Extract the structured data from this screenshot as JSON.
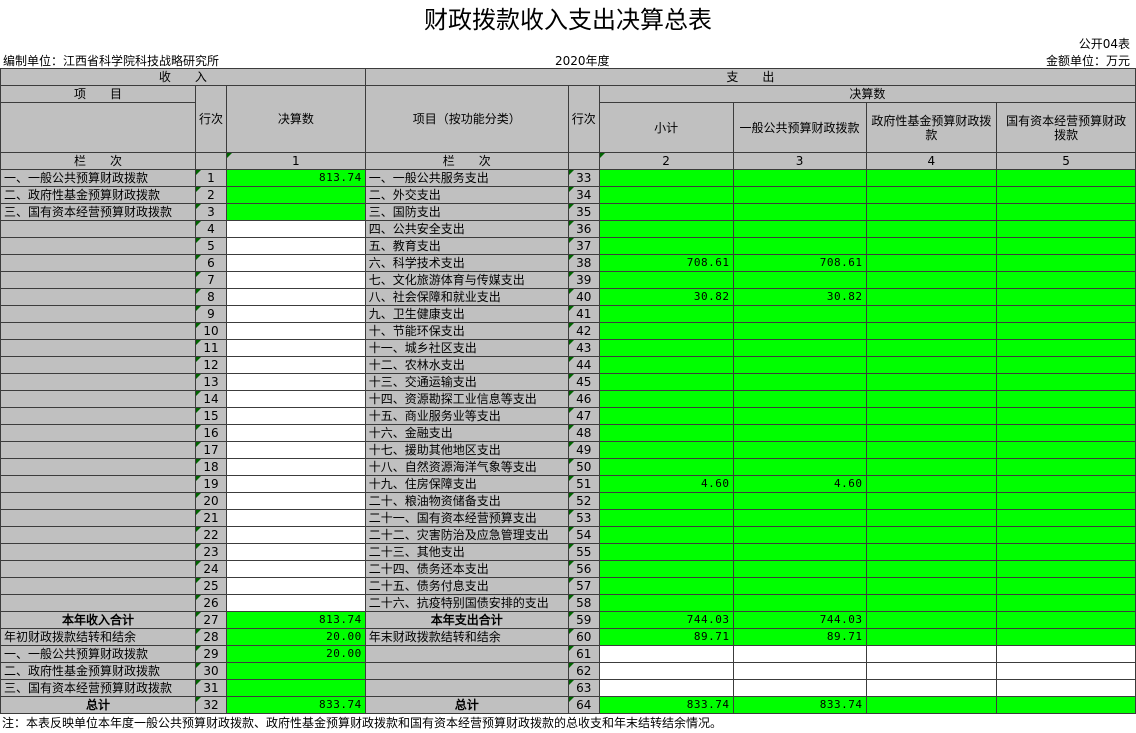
{
  "title": "财政拨款收入支出决算总表",
  "form_code": "公开04表",
  "unit_label": "编制单位：江西省科学院科技战略研究所",
  "year": "2020年度",
  "money_unit": "金额单位：万元",
  "header": {
    "income": "收　　入",
    "expense": "支　　出",
    "item": "项　　目",
    "seq": "行次",
    "amount": "决算数",
    "item_by_func": "项目（按功能分类）",
    "amount_group": "决算数",
    "subtotal": "小计",
    "general_budget": "一般公共预算财政拨款",
    "gov_fund": "政府性基金预算财政拨款",
    "state_capital": "国有资本经营预算财政拨款",
    "col_label": "栏　　次",
    "col1": "1",
    "col2": "2",
    "col3": "3",
    "col4": "4",
    "col5": "5"
  },
  "rows": [
    {
      "in_label": "一、一般公共预算财政拨款",
      "in_no": "1",
      "in_amt": "813.74",
      "ex_label": "一、一般公共服务支出",
      "ex_no": "33",
      "sub": "",
      "gen": "",
      "gov": "",
      "cap": ""
    },
    {
      "in_label": "二、政府性基金预算财政拨款",
      "in_no": "2",
      "in_amt": "",
      "ex_label": "二、外交支出",
      "ex_no": "34",
      "sub": "",
      "gen": "",
      "gov": "",
      "cap": ""
    },
    {
      "in_label": "三、国有资本经营预算财政拨款",
      "in_no": "3",
      "in_amt": "",
      "ex_label": "三、国防支出",
      "ex_no": "35",
      "sub": "",
      "gen": "",
      "gov": "",
      "cap": ""
    },
    {
      "in_label": "",
      "in_no": "4",
      "in_amt": "",
      "ex_label": "四、公共安全支出",
      "ex_no": "36",
      "sub": "",
      "gen": "",
      "gov": "",
      "cap": ""
    },
    {
      "in_label": "",
      "in_no": "5",
      "in_amt": "",
      "ex_label": "五、教育支出",
      "ex_no": "37",
      "sub": "",
      "gen": "",
      "gov": "",
      "cap": ""
    },
    {
      "in_label": "",
      "in_no": "6",
      "in_amt": "",
      "ex_label": "六、科学技术支出",
      "ex_no": "38",
      "sub": "708.61",
      "gen": "708.61",
      "gov": "",
      "cap": ""
    },
    {
      "in_label": "",
      "in_no": "7",
      "in_amt": "",
      "ex_label": "七、文化旅游体育与传媒支出",
      "ex_no": "39",
      "sub": "",
      "gen": "",
      "gov": "",
      "cap": ""
    },
    {
      "in_label": "",
      "in_no": "8",
      "in_amt": "",
      "ex_label": "八、社会保障和就业支出",
      "ex_no": "40",
      "sub": "30.82",
      "gen": "30.82",
      "gov": "",
      "cap": ""
    },
    {
      "in_label": "",
      "in_no": "9",
      "in_amt": "",
      "ex_label": "九、卫生健康支出",
      "ex_no": "41",
      "sub": "",
      "gen": "",
      "gov": "",
      "cap": ""
    },
    {
      "in_label": "",
      "in_no": "10",
      "in_amt": "",
      "ex_label": "十、节能环保支出",
      "ex_no": "42",
      "sub": "",
      "gen": "",
      "gov": "",
      "cap": ""
    },
    {
      "in_label": "",
      "in_no": "11",
      "in_amt": "",
      "ex_label": "十一、城乡社区支出",
      "ex_no": "43",
      "sub": "",
      "gen": "",
      "gov": "",
      "cap": ""
    },
    {
      "in_label": "",
      "in_no": "12",
      "in_amt": "",
      "ex_label": "十二、农林水支出",
      "ex_no": "44",
      "sub": "",
      "gen": "",
      "gov": "",
      "cap": ""
    },
    {
      "in_label": "",
      "in_no": "13",
      "in_amt": "",
      "ex_label": "十三、交通运输支出",
      "ex_no": "45",
      "sub": "",
      "gen": "",
      "gov": "",
      "cap": ""
    },
    {
      "in_label": "",
      "in_no": "14",
      "in_amt": "",
      "ex_label": "十四、资源勘探工业信息等支出",
      "ex_no": "46",
      "sub": "",
      "gen": "",
      "gov": "",
      "cap": ""
    },
    {
      "in_label": "",
      "in_no": "15",
      "in_amt": "",
      "ex_label": "十五、商业服务业等支出",
      "ex_no": "47",
      "sub": "",
      "gen": "",
      "gov": "",
      "cap": ""
    },
    {
      "in_label": "",
      "in_no": "16",
      "in_amt": "",
      "ex_label": "十六、金融支出",
      "ex_no": "48",
      "sub": "",
      "gen": "",
      "gov": "",
      "cap": ""
    },
    {
      "in_label": "",
      "in_no": "17",
      "in_amt": "",
      "ex_label": "十七、援助其他地区支出",
      "ex_no": "49",
      "sub": "",
      "gen": "",
      "gov": "",
      "cap": ""
    },
    {
      "in_label": "",
      "in_no": "18",
      "in_amt": "",
      "ex_label": "十八、自然资源海洋气象等支出",
      "ex_no": "50",
      "sub": "",
      "gen": "",
      "gov": "",
      "cap": ""
    },
    {
      "in_label": "",
      "in_no": "19",
      "in_amt": "",
      "ex_label": "十九、住房保障支出",
      "ex_no": "51",
      "sub": "4.60",
      "gen": "4.60",
      "gov": "",
      "cap": ""
    },
    {
      "in_label": "",
      "in_no": "20",
      "in_amt": "",
      "ex_label": "二十、粮油物资储备支出",
      "ex_no": "52",
      "sub": "",
      "gen": "",
      "gov": "",
      "cap": ""
    },
    {
      "in_label": "",
      "in_no": "21",
      "in_amt": "",
      "ex_label": "二十一、国有资本经营预算支出",
      "ex_no": "53",
      "sub": "",
      "gen": "",
      "gov": "",
      "cap": ""
    },
    {
      "in_label": "",
      "in_no": "22",
      "in_amt": "",
      "ex_label": "二十二、灾害防治及应急管理支出",
      "ex_no": "54",
      "sub": "",
      "gen": "",
      "gov": "",
      "cap": ""
    },
    {
      "in_label": "",
      "in_no": "23",
      "in_amt": "",
      "ex_label": "二十三、其他支出",
      "ex_no": "55",
      "sub": "",
      "gen": "",
      "gov": "",
      "cap": ""
    },
    {
      "in_label": "",
      "in_no": "24",
      "in_amt": "",
      "ex_label": "二十四、债务还本支出",
      "ex_no": "56",
      "sub": "",
      "gen": "",
      "gov": "",
      "cap": ""
    },
    {
      "in_label": "",
      "in_no": "25",
      "in_amt": "",
      "ex_label": "二十五、债务付息支出",
      "ex_no": "57",
      "sub": "",
      "gen": "",
      "gov": "",
      "cap": ""
    },
    {
      "in_label": "",
      "in_no": "26",
      "in_amt": "",
      "ex_label": "二十六、抗疫特别国债安排的支出",
      "ex_no": "58",
      "sub": "",
      "gen": "",
      "gov": "",
      "cap": ""
    }
  ],
  "totals": {
    "year_income": {
      "label": "本年收入合计",
      "no": "27",
      "amt": "813.74"
    },
    "year_expense": {
      "label": "本年支出合计",
      "no": "59",
      "sub": "744.03",
      "gen": "744.03"
    },
    "begin_balance": {
      "label": "年初财政拨款结转和结余",
      "no": "28",
      "amt": "20.00"
    },
    "end_balance": {
      "label": "年末财政拨款结转和结余",
      "no": "60",
      "sub": "89.71",
      "gen": "89.71"
    },
    "begin_general": {
      "label": "一、一般公共预算财政拨款",
      "no": "29",
      "amt": "20.00"
    },
    "ex_61": "61",
    "begin_gov": {
      "label": "二、政府性基金预算财政拨款",
      "no": "30"
    },
    "ex_62": "62",
    "begin_cap": {
      "label": "三、国有资本经营预算财政拨款",
      "no": "31"
    },
    "ex_63": "63",
    "grand_in": {
      "label": "总计",
      "no": "32",
      "amt": "833.74"
    },
    "grand_ex": {
      "label": "总计",
      "no": "64",
      "sub": "833.74",
      "gen": "833.74"
    }
  },
  "note": "注：本表反映单位本年度一般公共预算财政拨款、政府性基金预算财政拨款和国有资本经营预算财政拨款的总收支和年末结转结余情况。"
}
